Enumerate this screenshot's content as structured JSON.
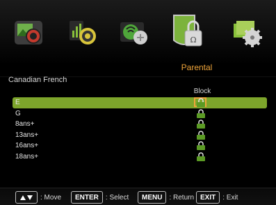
{
  "menu": {
    "items": [
      {
        "name": "Picture",
        "icon": "picture-icon"
      },
      {
        "name": "Sound",
        "icon": "sound-icon"
      },
      {
        "name": "Setup",
        "icon": "setup-icon"
      },
      {
        "name": "Parental",
        "icon": "parental-lock-icon"
      },
      {
        "name": "Options",
        "icon": "options-gear-icon"
      }
    ],
    "active_title": "Parental"
  },
  "section": {
    "title": "Canadian French",
    "column_header": "Block"
  },
  "ratings": [
    {
      "label": "E",
      "selected": true
    },
    {
      "label": "G",
      "selected": false
    },
    {
      "label": "8ans+",
      "selected": false
    },
    {
      "label": "13ans+",
      "selected": false
    },
    {
      "label": "16ans+",
      "selected": false
    },
    {
      "label": "18ans+",
      "selected": false
    }
  ],
  "hints": {
    "move_label": ": Move",
    "enter_key": "ENTER",
    "select_label": ": Select",
    "menu_key": "MENU",
    "return_label": ": Return",
    "exit_key": "EXIT",
    "exit_label": ": Exit"
  },
  "colors": {
    "accent": "#f0a53a",
    "selected_row": "#7da52b",
    "lock_green": "#5b9a24"
  }
}
